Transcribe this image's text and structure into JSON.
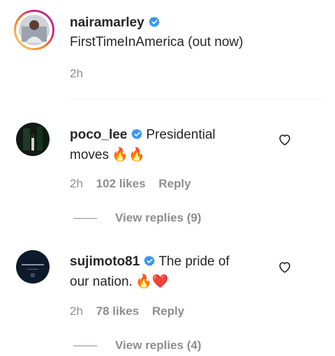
{
  "post": {
    "username": "nairamarley",
    "caption": "FirstTimeInAmerica (out now)",
    "time": "2h"
  },
  "comments": [
    {
      "username": "poco_lee",
      "text_line1": "Presidential",
      "text_line2": "moves",
      "emoji": "🔥🔥",
      "time": "2h",
      "likes": "102 likes",
      "reply": "Reply",
      "view_replies": "View replies (9)"
    },
    {
      "username": "sujimoto81",
      "text_line1": "The pride of",
      "text_line2": "our nation.",
      "emoji": "🔥❤️",
      "time": "2h",
      "likes": "78 likes",
      "reply": "Reply",
      "view_replies": "View replies (4)"
    }
  ],
  "icons": [
    "verified-badge-icon",
    "heart-outline-icon"
  ],
  "colors": {
    "verified": "#3897f0",
    "meta": "#8e8e8e",
    "text": "#262626",
    "story_ring": "#d6249f"
  }
}
